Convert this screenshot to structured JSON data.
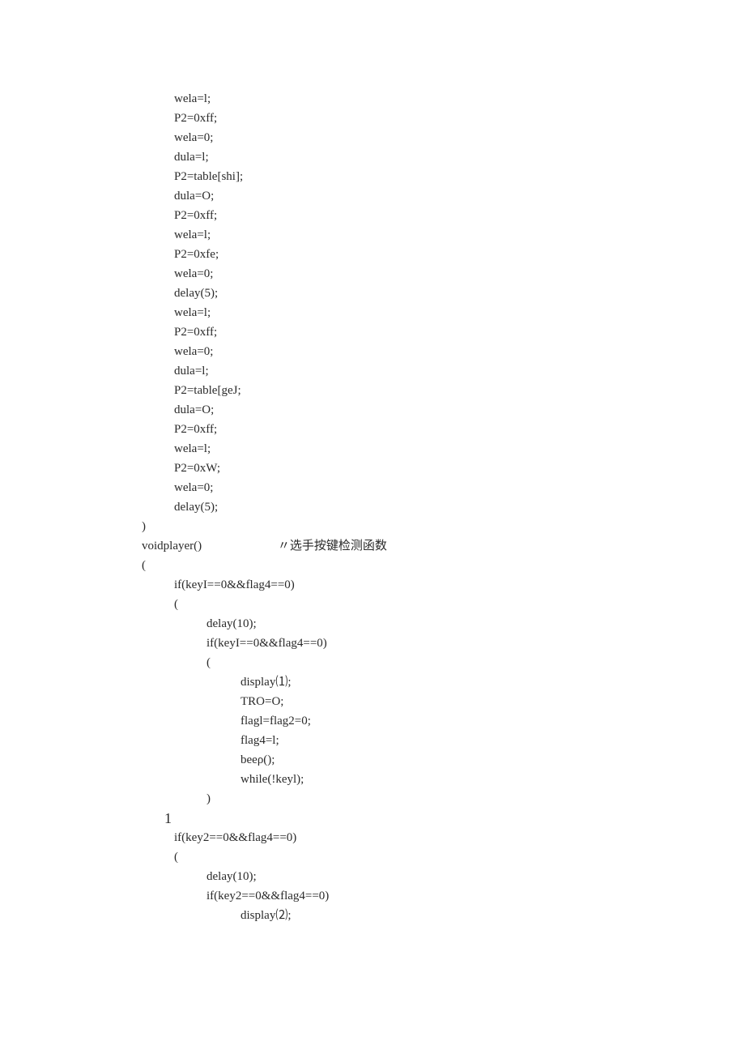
{
  "code": {
    "lines": [
      {
        "indent": 1,
        "text": "wela=l;"
      },
      {
        "indent": 1,
        "text": "P2=0xff;"
      },
      {
        "indent": 1,
        "text": "wela=0;"
      },
      {
        "indent": 1,
        "text": "dula=l;"
      },
      {
        "indent": 1,
        "text": "P2=table[shi];"
      },
      {
        "indent": 1,
        "text": "dula=O;"
      },
      {
        "indent": 1,
        "text": "P2=0xff;"
      },
      {
        "indent": 1,
        "text": "wela=l;"
      },
      {
        "indent": 1,
        "text": "P2=0xfe;"
      },
      {
        "indent": 1,
        "text": "wela=0;"
      },
      {
        "indent": 1,
        "text": "delay(5);"
      },
      {
        "indent": 1,
        "text": "wela=l;"
      },
      {
        "indent": 1,
        "text": "P2=0xff;"
      },
      {
        "indent": 1,
        "text": "wela=0;"
      },
      {
        "indent": 1,
        "text": "dula=l;"
      },
      {
        "indent": 1,
        "text": "P2=table[geJ;"
      },
      {
        "indent": 1,
        "text": "dula=O;"
      },
      {
        "indent": 1,
        "text": "P2=0xff;"
      },
      {
        "indent": 1,
        "text": "wela=l;"
      },
      {
        "indent": 1,
        "text": "P2=0xW;"
      },
      {
        "indent": 1,
        "text": "wela=0;"
      },
      {
        "indent": 1,
        "text": "delay(5);"
      },
      {
        "indent": 0,
        "text": ")"
      },
      {
        "indent": 0,
        "text": "voidplayer()",
        "annot": "选手按键检测函数"
      },
      {
        "indent": 0,
        "text": "("
      },
      {
        "indent": 1,
        "text": "if(keyI==0&&flag4==0)"
      },
      {
        "indent": 1,
        "text": "("
      },
      {
        "indent": 2,
        "text": "delay(10);"
      },
      {
        "indent": 2,
        "text": "if(keyI==0&&flag4==0)"
      },
      {
        "indent": 2,
        "text": "("
      },
      {
        "indent": 3,
        "text": "display⑴;"
      },
      {
        "indent": 3,
        "text": "TRO=O;"
      },
      {
        "indent": 3,
        "text": "flagl=flag2=0;"
      },
      {
        "indent": 3,
        "text": "flag4=l;"
      },
      {
        "indent": 3,
        "text": "beeρ();"
      },
      {
        "indent": 3,
        "text": "while(!keyl);"
      },
      {
        "indent": 2,
        "text": ")"
      },
      {
        "indent": 1,
        "text": "1",
        "big": true
      },
      {
        "indent": 1,
        "text": "if(key2==0&&flag4==0)"
      },
      {
        "indent": 1,
        "text": "("
      },
      {
        "indent": 2,
        "text": "delay(10);"
      },
      {
        "indent": 2,
        "text": "if(key2==0&&flag4==0)"
      },
      {
        "indent": 2,
        "text": ""
      },
      {
        "indent": 3,
        "text": "display⑵;"
      }
    ]
  }
}
